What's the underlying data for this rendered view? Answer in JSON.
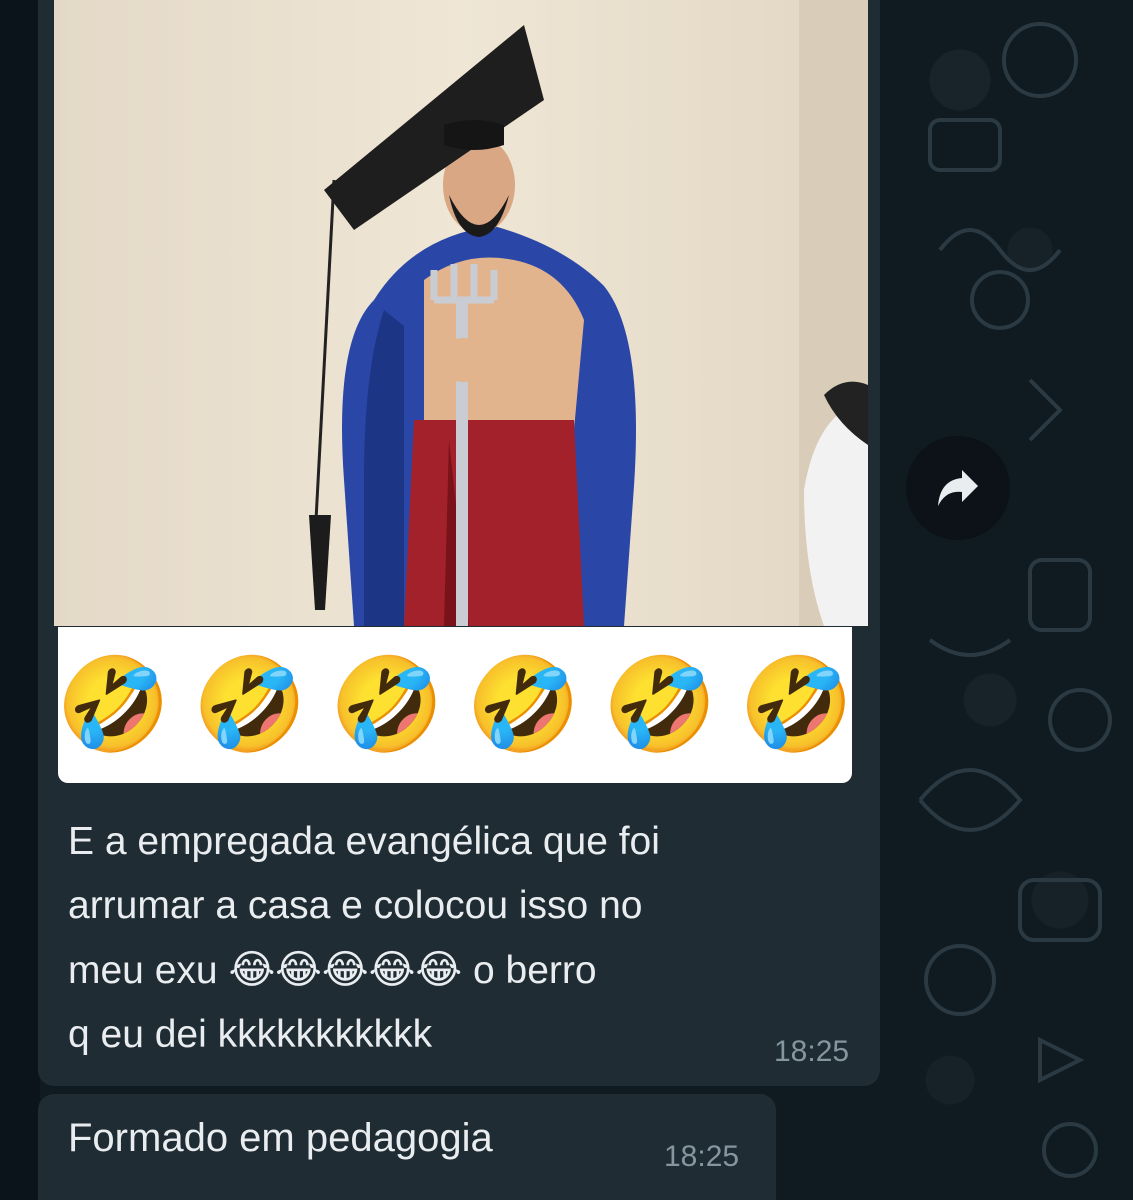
{
  "messages": [
    {
      "type": "image",
      "image_description": "statue",
      "caption_emojis": [
        "🤣",
        "🤣",
        "🤣",
        "🤣",
        "🤣",
        "🤣"
      ],
      "text_line1": "E a empregada evangélica que foi",
      "text_line2": "arrumar a casa e colocou isso no",
      "text_line3_start": "meu exu",
      "text_line3_emojis": "😂😂😂😂😂",
      "text_line3_end": "o berro",
      "text_line4": "q eu dei kkkkkkkkkkk",
      "time": "18:25"
    },
    {
      "type": "text",
      "text": "Formado em pedagogia",
      "time": "18:25"
    }
  ],
  "forward_icon": "forward-arrow-icon",
  "colors": {
    "bubble": "#1f2c34",
    "background": "#0b141a",
    "text": "#e9edef",
    "timestamp": "#8696a0"
  }
}
